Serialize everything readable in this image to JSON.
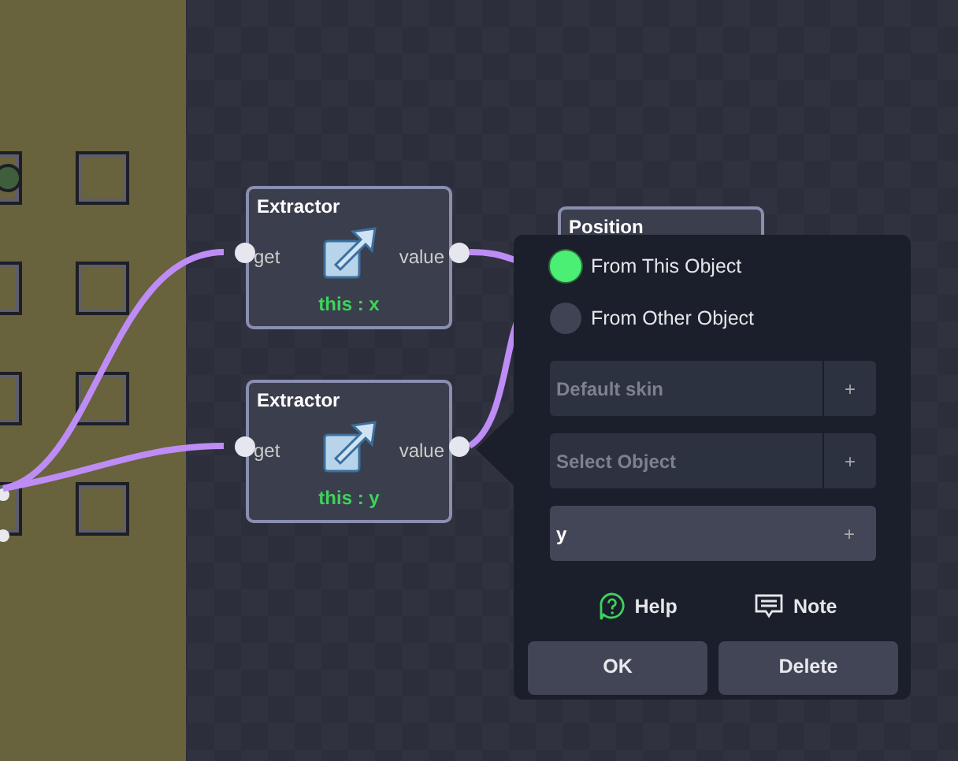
{
  "inventory": {
    "slots": [
      {
        "kind": "item"
      },
      {
        "kind": "empty"
      },
      {
        "kind": "empty"
      },
      {
        "kind": "empty"
      },
      {
        "kind": "empty"
      },
      {
        "kind": "empty"
      },
      {
        "kind": "socket"
      },
      {
        "kind": "empty"
      }
    ]
  },
  "nodes": [
    {
      "title": "Extractor",
      "input": "get",
      "output": "value",
      "value": "this : x"
    },
    {
      "title": "Extractor",
      "input": "get",
      "output": "value",
      "value": "this : y"
    },
    {
      "title": "Position"
    }
  ],
  "popup": {
    "options": [
      {
        "label": "From This Object",
        "selected": true
      },
      {
        "label": "From Other Object",
        "selected": false
      }
    ],
    "fields": [
      {
        "placeholder": "Default skin",
        "button": "+"
      },
      {
        "placeholder": "Select Object",
        "button": "+"
      },
      {
        "value": "y",
        "button": "+"
      }
    ],
    "links": [
      "Help",
      "Note"
    ],
    "buttons": [
      "OK",
      "Delete"
    ]
  }
}
